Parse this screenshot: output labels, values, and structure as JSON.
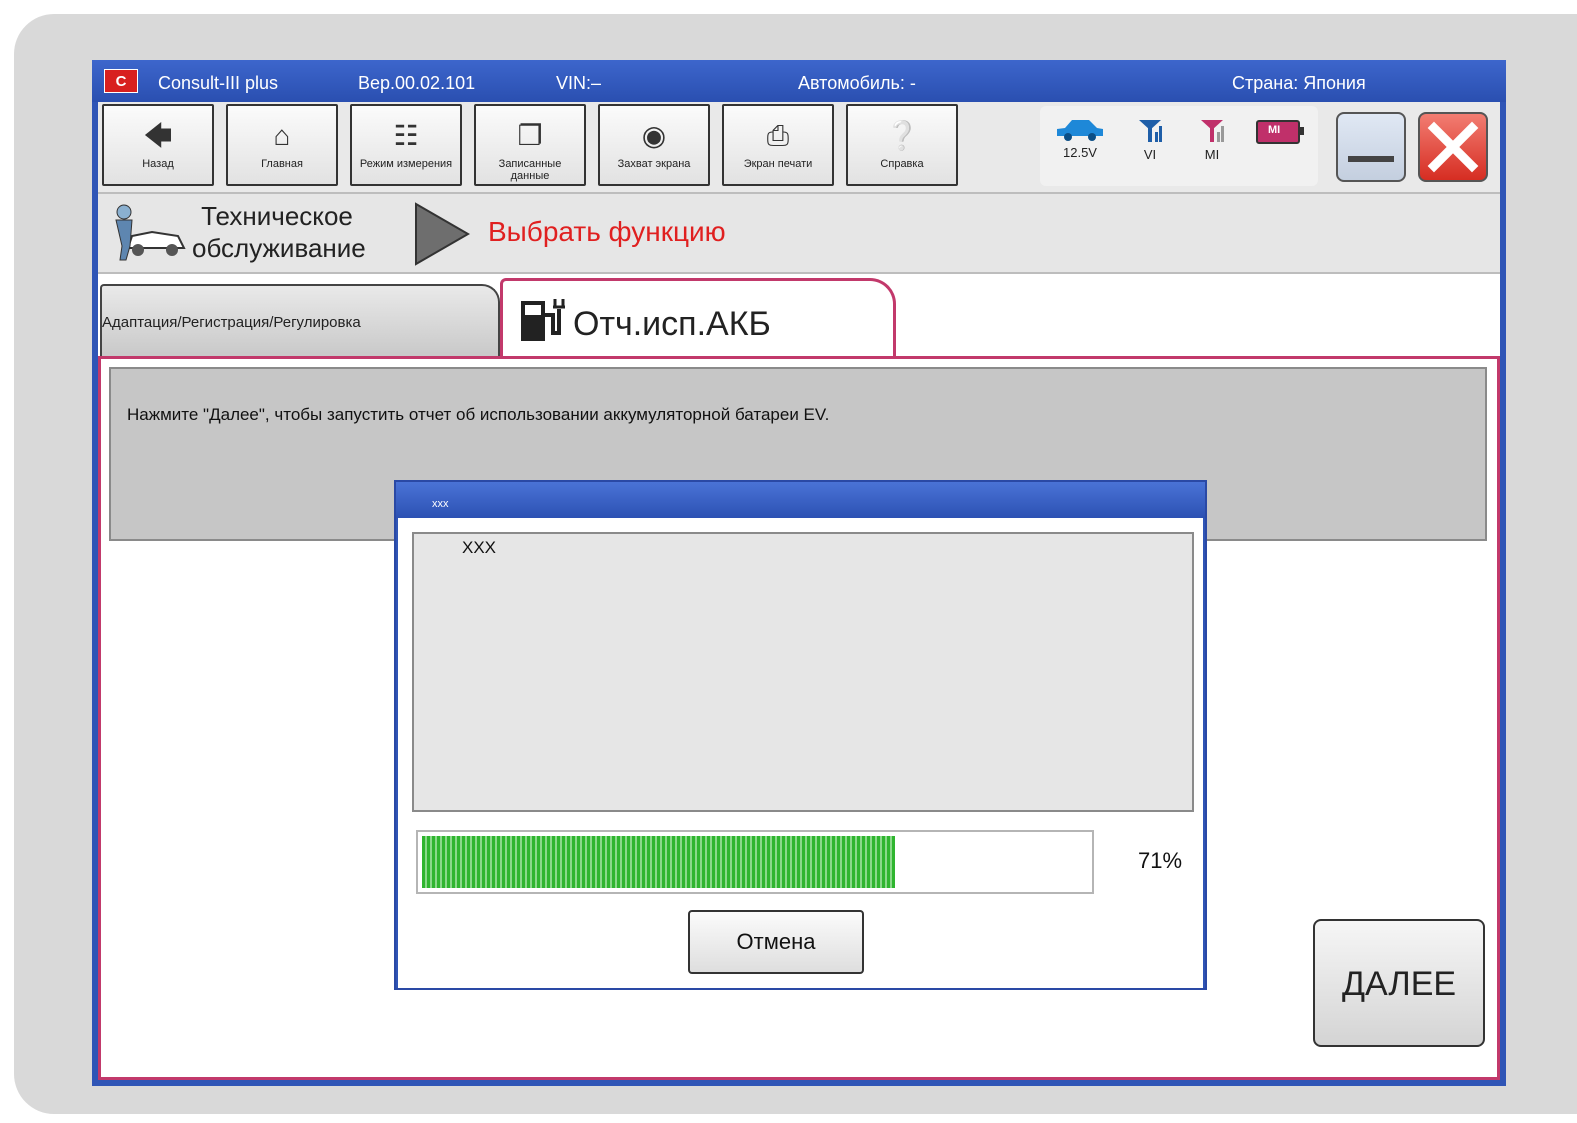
{
  "titlebar": {
    "app_name": "Consult-III plus",
    "logo_text": "C-III",
    "version": "Вер.00.02.101",
    "vin": "VIN:–",
    "vehicle": "Автомобиль: -",
    "country": "Страна: Япония"
  },
  "toolbar": {
    "buttons": [
      {
        "label": "Назад",
        "icon": "back-arrow-icon"
      },
      {
        "label": "Главная",
        "icon": "home-icon"
      },
      {
        "label": "Режим измерения",
        "icon": "measurement-icon"
      },
      {
        "label": "Записанные данные",
        "icon": "recorded-data-icon"
      },
      {
        "label": "Захват экрана",
        "icon": "camera-icon"
      },
      {
        "label": "Экран печати",
        "icon": "printer-icon"
      },
      {
        "label": "Справка",
        "icon": "help-icon"
      }
    ],
    "status": {
      "voltage": "12.5V",
      "vi_label": "VI",
      "mi_label": "MI",
      "battery_label": "MI"
    }
  },
  "breadcrumb": {
    "section_line1": "Техническое",
    "section_line2": "обслуживание",
    "current": "Выбрать функцию"
  },
  "tabs": {
    "inactive": "Адаптация/Регистрация/Регулировка",
    "active": "Отч.исп.АКБ"
  },
  "message": "Нажмите \"Далее\", чтобы запустить отчет об использовании аккумуляторной батареи EV.",
  "dialog": {
    "title": "xxx",
    "body_text": "XXX",
    "progress_value": 71,
    "progress_text": "71%",
    "cancel_label": "Отмена"
  },
  "next_label": "ДАЛЕЕ",
  "colors": {
    "accent_red": "#e02020",
    "tab_border": "#c2396b",
    "window_blue": "#2f55b6",
    "progress_green": "#2fb52f"
  }
}
